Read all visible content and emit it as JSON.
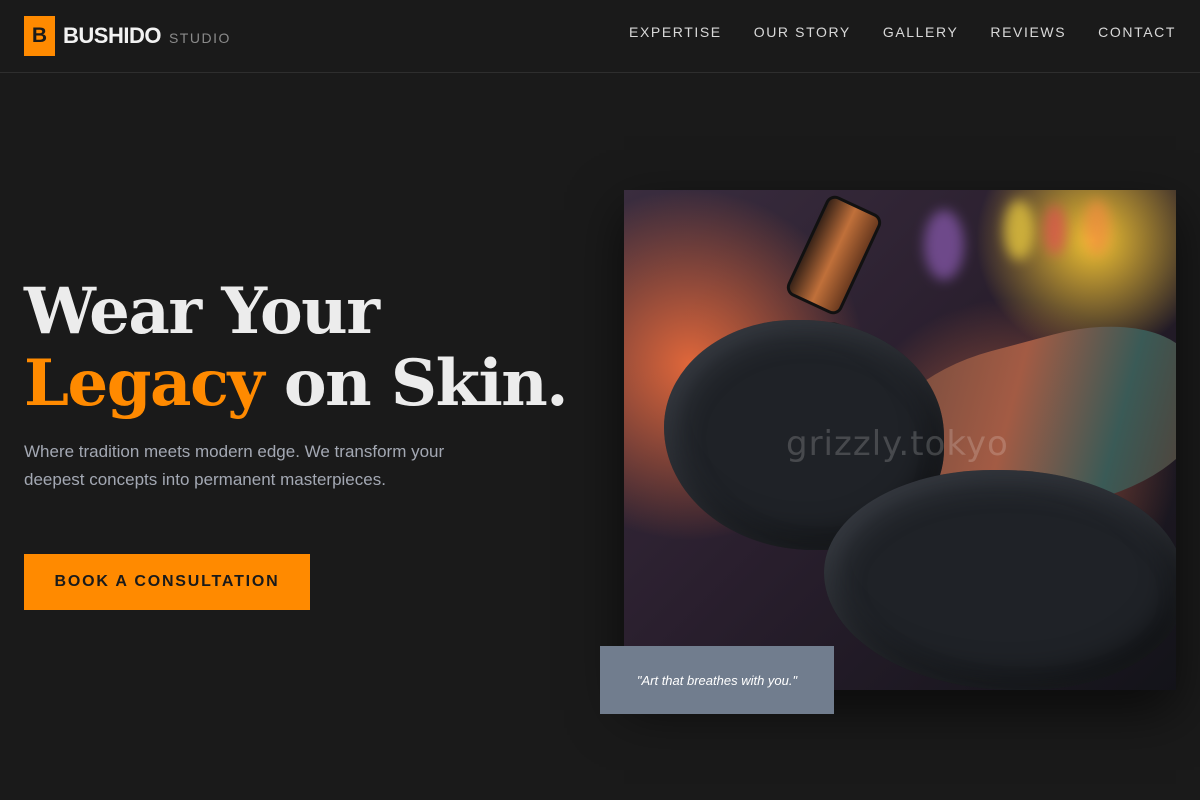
{
  "header": {
    "logo_mark": "B",
    "logo_name": "BUSHIDO",
    "logo_sub": "STUDIO",
    "nav": [
      {
        "label": "EXPERTISE"
      },
      {
        "label": "OUR STORY"
      },
      {
        "label": "GALLERY"
      },
      {
        "label": "REVIEWS"
      },
      {
        "label": "CONTACT"
      }
    ]
  },
  "hero": {
    "title_line1": "Wear Your",
    "title_accent": "Legacy",
    "title_rest": " on Skin.",
    "description": "Where tradition meets modern edge. We transform your deepest concepts into permanent masterpieces.",
    "cta_label": "BOOK A CONSULTATION",
    "image_watermark": "grizzly.tokyo",
    "quote": "\"Art that breathes with you.\""
  },
  "colors": {
    "background": "#1a1a1a",
    "accent": "#ff8a00",
    "quote_card": "#717d8e",
    "text_primary": "#ececec",
    "text_muted": "#a3a8b3"
  }
}
